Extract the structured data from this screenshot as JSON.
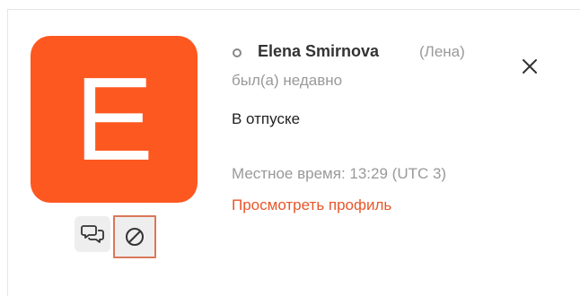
{
  "contact": {
    "avatar_letter": "E",
    "avatar_color": "#fe5821",
    "name": "Elena Smirnova",
    "nickname": "(Лена)",
    "last_seen": "был(а) недавно",
    "status_text": "В отпуске",
    "local_time": "Местное время: 13:29 (UTC 3)",
    "profile_link": "Просмотреть профиль"
  },
  "icons": {
    "presence": "offline-status-icon",
    "chat": "chat-bubbles-icon",
    "block": "block-icon",
    "close": "close-icon"
  },
  "colors": {
    "accent": "#e8562a",
    "muted_text": "#999999",
    "button_bg": "#eeeeee",
    "focus_border": "#d9785a"
  }
}
